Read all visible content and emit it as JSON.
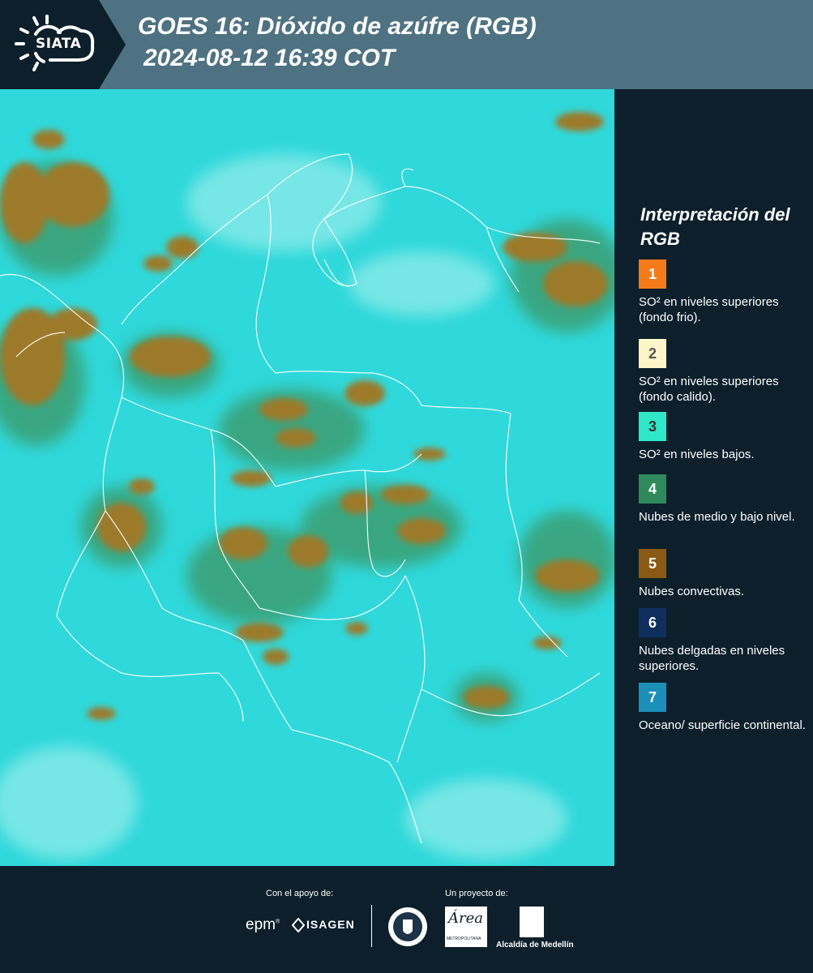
{
  "header": {
    "logo_text": "SIATA",
    "title": "GOES 16: Dióxido de azúfre (RGB)",
    "datetime": "2024-08-12 16:39 COT"
  },
  "map": {
    "background_color": "#2fd8da",
    "cloud_color": "#9c7a2a",
    "cloud_edge_color": "#3f9e6e",
    "border_color": "#ffffff"
  },
  "legend": {
    "title": "Interpretación del RGB",
    "items": [
      {
        "number": "1",
        "label": "SO² en niveles superiores (fondo frio).",
        "color": "#f47a1a",
        "number_color": "#ffffff"
      },
      {
        "number": "2",
        "label": "SO² en niveles superiores (fondo calido).",
        "color": "#fdf5c8",
        "number_color": "#555555"
      },
      {
        "number": "3",
        "label": "SO² en niveles bajos.",
        "color": "#2fe8c8",
        "number_color": "#333333"
      },
      {
        "number": "4",
        "label": "Nubes de medio y bajo nivel.",
        "color": "#2e8a5c",
        "number_color": "#ffffff"
      },
      {
        "number": "5",
        "label": "Nubes convectivas.",
        "color": "#8a5a14",
        "number_color": "#ffffff"
      },
      {
        "number": "6",
        "label": "Nubes delgadas en niveles superiores.",
        "color": "#0e2f5e",
        "number_color": "#ffffff"
      },
      {
        "number": "7",
        "label": "Oceano/ superficie continental.",
        "color": "#1b8fb8",
        "number_color": "#ffffff"
      }
    ]
  },
  "footer": {
    "support_label": "Con el apoyo de:",
    "project_label": "Un proyecto de:",
    "sponsor_1": "epm",
    "sponsor_2": "ISAGEN",
    "partner_1": "Área Metropolitana Valle de Aburrá",
    "partner_2": "Alcaldía de Medellín"
  }
}
